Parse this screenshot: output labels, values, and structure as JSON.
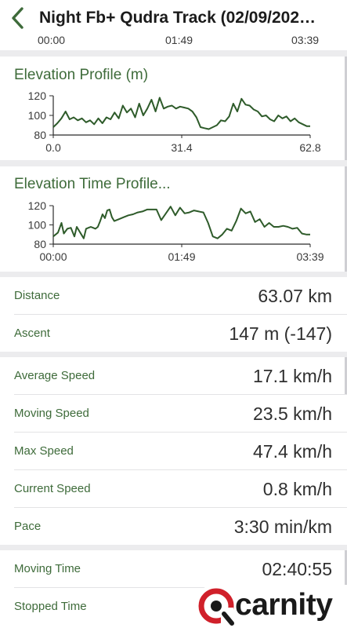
{
  "header": {
    "title": "Night Fb+ Qudra Track (02/09/202…"
  },
  "top_axis": {
    "ticks": [
      "00:00",
      "01:49",
      "03:39"
    ]
  },
  "chart_data": [
    {
      "type": "line",
      "title": "Elevation Profile (m)",
      "xlabel": "",
      "ylabel": "",
      "x_ticks": [
        "0.0",
        "31.4",
        "62.8"
      ],
      "y_ticks": [
        "80",
        "100",
        "120"
      ],
      "xlim": [
        0,
        62.8
      ],
      "ylim": [
        80,
        120
      ],
      "grid": false,
      "color": "#2e5b2a",
      "series": [
        {
          "x": [
            0,
            1,
            2,
            3,
            4,
            5,
            6,
            7,
            8,
            9,
            10,
            11,
            12,
            13,
            14,
            15,
            16,
            17,
            18,
            19,
            20,
            21,
            22,
            23,
            24,
            25,
            26,
            27,
            28,
            29,
            30,
            31,
            32,
            33,
            34,
            35,
            36,
            37,
            38,
            39,
            40,
            41,
            42,
            43,
            44,
            45,
            46,
            47,
            48,
            49,
            50,
            51,
            52,
            53,
            54,
            55,
            56,
            57,
            58,
            59,
            60,
            61,
            62,
            62.8
          ],
          "y": [
            88,
            92,
            97,
            104,
            96,
            98,
            95,
            97,
            93,
            95,
            91,
            97,
            92,
            98,
            96,
            103,
            97,
            110,
            103,
            107,
            98,
            112,
            100,
            107,
            116,
            104,
            118,
            107,
            109,
            110,
            107,
            109,
            108,
            107,
            104,
            98,
            88,
            87,
            86,
            88,
            90,
            95,
            94,
            99,
            112,
            104,
            117,
            111,
            110,
            106,
            104,
            99,
            100,
            96,
            94,
            100,
            97,
            99,
            94,
            97,
            93,
            91,
            89,
            89
          ]
        }
      ]
    },
    {
      "type": "line",
      "title": "Elevation Time Profile...",
      "xlabel": "",
      "ylabel": "",
      "x_ticks": [
        "00:00",
        "01:49",
        "03:39"
      ],
      "y_ticks": [
        "80",
        "100",
        "120"
      ],
      "xlim": [
        0,
        219
      ],
      "ylim": [
        80,
        120
      ],
      "grid": false,
      "color": "#2e5b2a",
      "series": [
        {
          "x": [
            0,
            4,
            7,
            9,
            12,
            15,
            18,
            20,
            23,
            26,
            28,
            30,
            32,
            34,
            36,
            38,
            40,
            42,
            44,
            46,
            48,
            50,
            52,
            56,
            60,
            64,
            68,
            72,
            76,
            80,
            84,
            88,
            92,
            96,
            100,
            104,
            108,
            112,
            116,
            120,
            124,
            128,
            132,
            136,
            140,
            144,
            148,
            152,
            156,
            160,
            164,
            168,
            172,
            176,
            180,
            184,
            188,
            192,
            196,
            200,
            204,
            208,
            212,
            216,
            219
          ],
          "y": [
            88,
            92,
            102,
            91,
            96,
            97,
            88,
            98,
            92,
            86,
            96,
            97,
            98,
            97,
            96,
            98,
            104,
            111,
            107,
            115,
            116,
            108,
            104,
            106,
            108,
            110,
            111,
            113,
            114,
            116,
            116,
            116,
            105,
            112,
            119,
            110,
            118,
            112,
            113,
            115,
            114,
            113,
            102,
            88,
            86,
            90,
            96,
            94,
            104,
            117,
            112,
            114,
            103,
            106,
            98,
            102,
            98,
            98,
            99,
            98,
            96,
            97,
            91,
            90,
            90
          ]
        }
      ]
    }
  ],
  "stats_group1": [
    {
      "label": "Distance",
      "value": "63.07 km"
    },
    {
      "label": "Ascent",
      "value": "147 m (-147)"
    }
  ],
  "stats_group2": [
    {
      "label": "Average Speed",
      "value": "17.1 km/h"
    },
    {
      "label": "Moving Speed",
      "value": "23.5 km/h"
    },
    {
      "label": "Max Speed",
      "value": "47.4 km/h"
    },
    {
      "label": "Current Speed",
      "value": "0.8 km/h"
    },
    {
      "label": "Pace",
      "value": "3:30 min/km"
    }
  ],
  "stats_group3": [
    {
      "label": "Moving Time",
      "value": "02:40:55"
    },
    {
      "label": "Stopped Time",
      "value": ""
    }
  ],
  "watermark": {
    "text": "carnity",
    "icon": "carnity-logo-icon",
    "color": "#d0202a"
  }
}
